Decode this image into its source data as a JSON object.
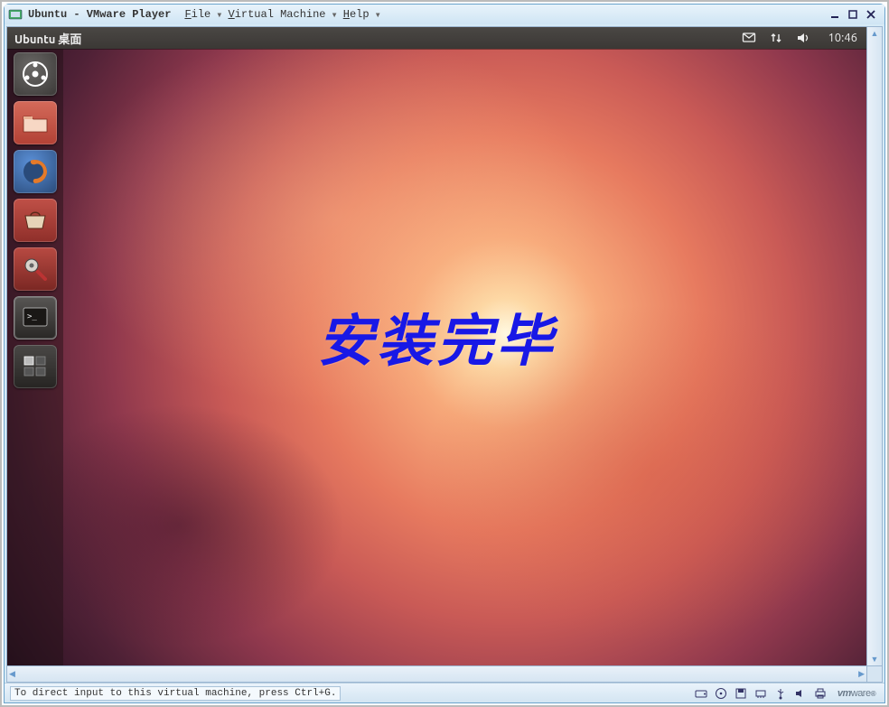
{
  "vmware": {
    "title": "Ubuntu - VMware Player",
    "menus": {
      "file": "File",
      "vm": "Virtual Machine",
      "help": "Help"
    },
    "status_text": "To direct input to this virtual machine, press Ctrl+G.",
    "logo": "vmware"
  },
  "ubuntu": {
    "panel_label": "Ubuntu 桌面",
    "clock": "10:46",
    "overlay_text": "安装完毕",
    "launcher": {
      "dash": "dash-home",
      "files": "files",
      "firefox": "firefox",
      "software": "software-center",
      "settings": "system-settings",
      "terminal": "terminal",
      "workspace": "workspace-switcher"
    },
    "indicators": {
      "mail": "messages-icon",
      "network": "network-icon",
      "sound": "sound-icon"
    }
  }
}
